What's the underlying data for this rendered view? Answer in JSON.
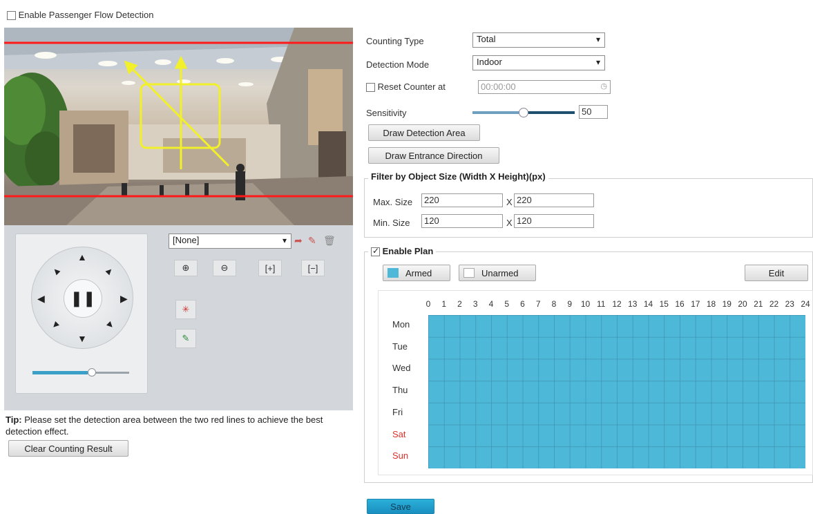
{
  "enable_detection": {
    "label": "Enable Passenger Flow Detection",
    "checked": false
  },
  "video": {
    "icon": "mall-camera-preview"
  },
  "ptz": {
    "preset_select": "[None]",
    "zoom_in_icon": "zoom-in-icon",
    "zoom_out_icon": "zoom-out-icon",
    "focus_near_icon": "focus-near-icon",
    "focus_far_icon": "focus-far-icon",
    "iris_icon": "iris-icon",
    "light_icon": "light-icon",
    "pause_icon": "pause-icon"
  },
  "tip": {
    "prefix": "Tip:",
    "text": " Please set the detection area between the two red lines to achieve the best detection effect."
  },
  "clear_button": "Clear Counting Result",
  "settings": {
    "counting_type_label": "Counting Type",
    "counting_type_value": "Total",
    "detection_mode_label": "Detection Mode",
    "detection_mode_value": "Indoor",
    "reset_counter_label": "Reset Counter at",
    "reset_counter_checked": false,
    "reset_counter_time": "00:00:00",
    "sensitivity_label": "Sensitivity",
    "sensitivity_value": "50",
    "sensitivity_level": 0.5,
    "draw_area_button": "Draw Detection Area",
    "draw_direction_button": "Draw Entrance Direction"
  },
  "filter": {
    "title": "Filter by Object Size (Width X Height)(px)",
    "max_label": "Max. Size",
    "max_w": "220",
    "max_h": "220",
    "min_label": "Min. Size",
    "min_w": "120",
    "min_h": "120",
    "x": "X"
  },
  "plan": {
    "enable_label": "Enable Plan",
    "enabled": true,
    "armed_label": "Armed",
    "unarmed_label": "Unarmed",
    "edit_button": "Edit",
    "armed_color": "#4db8d8",
    "hours": [
      "0",
      "1",
      "2",
      "3",
      "4",
      "5",
      "6",
      "7",
      "8",
      "9",
      "10",
      "11",
      "12",
      "13",
      "14",
      "15",
      "16",
      "17",
      "18",
      "19",
      "20",
      "21",
      "22",
      "23",
      "24"
    ],
    "days": [
      "Mon",
      "Tue",
      "Wed",
      "Thu",
      "Fri",
      "Sat",
      "Sun"
    ],
    "weekend_color": "#e0302a"
  },
  "save_button": "Save"
}
